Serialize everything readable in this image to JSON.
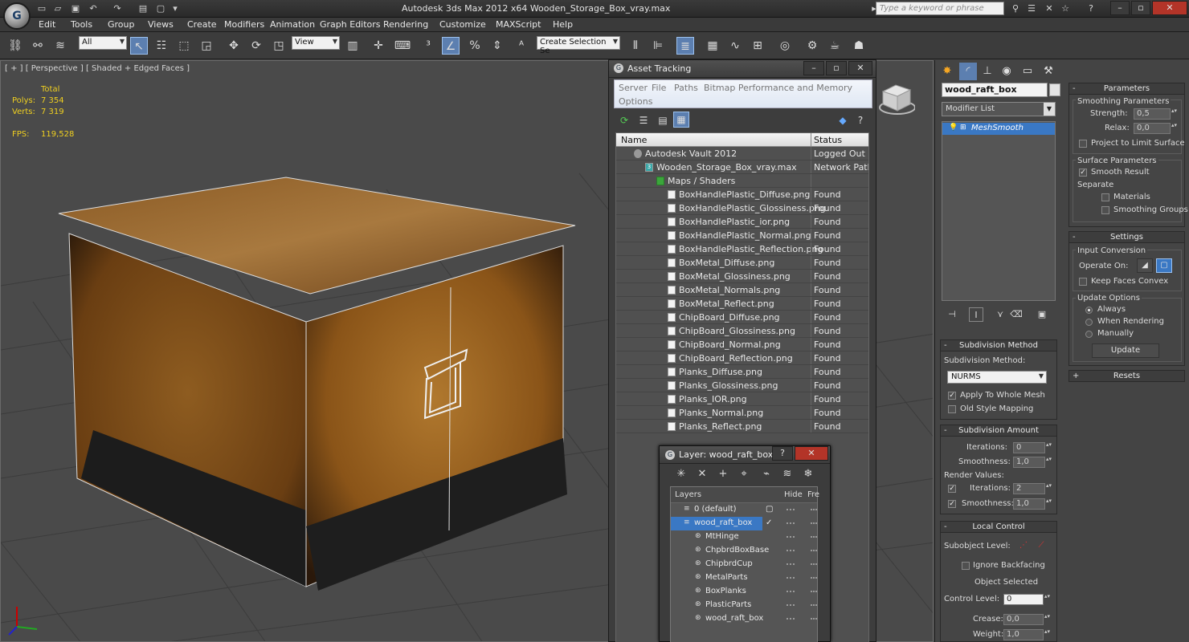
{
  "app": {
    "title": "Autodesk 3ds Max  2012 x64     Wooden_Storage_Box_vray.max",
    "search_placeholder": "Type a keyword or phrase",
    "logo_glyph": "G"
  },
  "menu": [
    "Edit",
    "Tools",
    "Group",
    "Views",
    "Create",
    "Modifiers",
    "Animation",
    "Graph Editors",
    "Rendering",
    "Customize",
    "MAXScript",
    "Help"
  ],
  "toolbar": {
    "filter_value": "All",
    "refcoord_value": "View",
    "selection_set_placeholder": "Create Selection Se"
  },
  "viewport": {
    "label": "[ + ] [ Perspective ] [ Shaded + Edged Faces ]",
    "stats": {
      "total_label": "Total",
      "polys_label": "Polys:",
      "polys_value": "7 354",
      "verts_label": "Verts:",
      "verts_value": "7 319",
      "fps_label": "FPS:",
      "fps_value": "119,528"
    },
    "viewcube_label": "[Le]F|rnt]"
  },
  "asset_tracking": {
    "title": "Asset Tracking",
    "menu": [
      "Server",
      "File",
      "Paths",
      "Bitmap Performance and Memory",
      "Options"
    ],
    "columns": {
      "name": "Name",
      "status": "Status"
    },
    "rows": [
      {
        "name": "Autodesk Vault 2012",
        "status": "Logged Out ...",
        "indent": 0,
        "icon": "vault-icon"
      },
      {
        "name": "Wooden_Storage_Box_vray.max",
        "status": "Network Path",
        "indent": 1,
        "icon": "max-file-icon"
      },
      {
        "name": "Maps / Shaders",
        "status": "",
        "indent": 2,
        "icon": "maps-folder-icon"
      },
      {
        "name": "BoxHandlePlastic_Diffuse.png",
        "status": "Found",
        "indent": 3,
        "icon": "bitmap-icon"
      },
      {
        "name": "BoxHandlePlastic_Glossiness.png",
        "status": "Found",
        "indent": 3,
        "icon": "bitmap-icon"
      },
      {
        "name": "BoxHandlePlastic_ior.png",
        "status": "Found",
        "indent": 3,
        "icon": "bitmap-icon"
      },
      {
        "name": "BoxHandlePlastic_Normal.png",
        "status": "Found",
        "indent": 3,
        "icon": "bitmap-icon"
      },
      {
        "name": "BoxHandlePlastic_Reflection.png",
        "status": "Found",
        "indent": 3,
        "icon": "bitmap-icon"
      },
      {
        "name": "BoxMetal_Diffuse.png",
        "status": "Found",
        "indent": 3,
        "icon": "bitmap-icon"
      },
      {
        "name": "BoxMetal_Glossiness.png",
        "status": "Found",
        "indent": 3,
        "icon": "bitmap-icon"
      },
      {
        "name": "BoxMetal_Normals.png",
        "status": "Found",
        "indent": 3,
        "icon": "bitmap-icon"
      },
      {
        "name": "BoxMetal_Reflect.png",
        "status": "Found",
        "indent": 3,
        "icon": "bitmap-icon"
      },
      {
        "name": "ChipBoard_Diffuse.png",
        "status": "Found",
        "indent": 3,
        "icon": "bitmap-icon"
      },
      {
        "name": "ChipBoard_Glossiness.png",
        "status": "Found",
        "indent": 3,
        "icon": "bitmap-icon"
      },
      {
        "name": "ChipBoard_Normal.png",
        "status": "Found",
        "indent": 3,
        "icon": "bitmap-icon"
      },
      {
        "name": "ChipBoard_Reflection.png",
        "status": "Found",
        "indent": 3,
        "icon": "bitmap-icon"
      },
      {
        "name": "Planks_Diffuse.png",
        "status": "Found",
        "indent": 3,
        "icon": "bitmap-icon"
      },
      {
        "name": "Planks_Glossiness.png",
        "status": "Found",
        "indent": 3,
        "icon": "bitmap-icon"
      },
      {
        "name": "Planks_IOR.png",
        "status": "Found",
        "indent": 3,
        "icon": "bitmap-icon"
      },
      {
        "name": "Planks_Normal.png",
        "status": "Found",
        "indent": 3,
        "icon": "bitmap-icon"
      },
      {
        "name": "Planks_Reflect.png",
        "status": "Found",
        "indent": 3,
        "icon": "bitmap-icon"
      }
    ]
  },
  "layer_dialog": {
    "title": "Layer: wood_raft_box",
    "help": "?",
    "columns": {
      "layers": "Layers",
      "hide": "Hide",
      "freeze": "Fre"
    },
    "rows": [
      {
        "name": "0 (default)",
        "indent": 0,
        "selected": false,
        "current": false
      },
      {
        "name": "wood_raft_box",
        "indent": 0,
        "selected": true,
        "current": true
      },
      {
        "name": "MtHinge",
        "indent": 1,
        "selected": false,
        "current": false
      },
      {
        "name": "ChpbrdBoxBase",
        "indent": 1,
        "selected": false,
        "current": false
      },
      {
        "name": "ChipbrdCup",
        "indent": 1,
        "selected": false,
        "current": false
      },
      {
        "name": "MetalParts",
        "indent": 1,
        "selected": false,
        "current": false
      },
      {
        "name": "BoxPlanks",
        "indent": 1,
        "selected": false,
        "current": false
      },
      {
        "name": "PlasticParts",
        "indent": 1,
        "selected": false,
        "current": false
      },
      {
        "name": "wood_raft_box",
        "indent": 1,
        "selected": false,
        "current": false
      }
    ]
  },
  "command_panel": {
    "object_name": "wood_raft_box",
    "modifier_list": "Modifier List",
    "stack_item": "MeshSmooth",
    "subdivision_method": {
      "title": "Subdivision Method",
      "method_label": "Subdivision Method:",
      "method_value": "NURMS",
      "apply_whole_mesh": "Apply To Whole Mesh",
      "old_style_mapping": "Old Style Mapping"
    },
    "subdivision_amount": {
      "title": "Subdivision Amount",
      "iterations_label": "Iterations:",
      "iterations_value": "0",
      "smoothness_label": "Smoothness:",
      "smoothness_value": "1,0",
      "render_values_label": "Render Values:",
      "render_iterations_label": "Iterations:",
      "render_iterations_value": "2",
      "render_smoothness_label": "Smoothness:",
      "render_smoothness_value": "1,0"
    },
    "local_control": {
      "title": "Local Control",
      "subobject_label": "Subobject Level:",
      "ignore_backfacing": "Ignore Backfacing",
      "object_selected": "Object Selected",
      "control_level_label": "Control Level:",
      "control_level_value": "0",
      "crease_label": "Crease:",
      "crease_value": "0,0",
      "weight_label": "Weight:",
      "weight_value": "1,0"
    },
    "parameters": {
      "title": "Parameters",
      "smoothing_params": "Smoothing Parameters",
      "strength_label": "Strength:",
      "strength_value": "0,5",
      "relax_label": "Relax:",
      "relax_value": "0,0",
      "project_limit": "Project to Limit Surface",
      "surface_params": "Surface Parameters",
      "smooth_result": "Smooth Result",
      "separate_label": "Separate",
      "materials": "Materials",
      "smoothing_groups": "Smoothing Groups"
    },
    "settings": {
      "title": "Settings",
      "input_conversion": "Input Conversion",
      "operate_on": "Operate On:",
      "keep_faces_convex": "Keep Faces Convex",
      "update_options": "Update Options",
      "always": "Always",
      "when_rendering": "When Rendering",
      "manually": "Manually",
      "update_button": "Update"
    },
    "resets": {
      "title": "Resets"
    }
  },
  "colors": {
    "selection_blue": "#3a78c4",
    "stat_yellow": "#f0d020",
    "close_red": "#b33428"
  }
}
